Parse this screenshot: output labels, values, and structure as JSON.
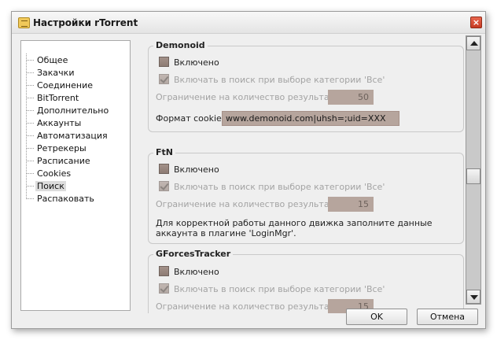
{
  "window": {
    "title": "Настройки rTorrent",
    "close_label": "×"
  },
  "sidebar": {
    "items": [
      {
        "label": "Общее"
      },
      {
        "label": "Закачки"
      },
      {
        "label": "Соединение"
      },
      {
        "label": "BitTorrent"
      },
      {
        "label": "Дополнительно"
      },
      {
        "label": "Аккаунты"
      },
      {
        "label": "Автоматизация"
      },
      {
        "label": "Ретрекеры"
      },
      {
        "label": "Расписание"
      },
      {
        "label": "Cookies"
      },
      {
        "label": "Поиск",
        "selected": true
      },
      {
        "label": "Распаковать"
      }
    ]
  },
  "engines": [
    {
      "name": "Demonoid",
      "enabled_label": "Включено",
      "enabled": false,
      "include_all_label": "Включать в поиск при выборе категории 'Все'",
      "include_all": true,
      "limit_label": "Ограничение на количество результатов:",
      "limit_value": "50",
      "cookies_label": "Формат cookies:",
      "cookies_value": "www.demonoid.com|uhsh=;uid=XXX"
    },
    {
      "name": "FtN",
      "enabled_label": "Включено",
      "enabled": false,
      "include_all_label": "Включать в поиск при выборе категории 'Все'",
      "include_all": true,
      "limit_label": "Ограничение на количество результатов:",
      "limit_value": "15",
      "note": "Для корректной работы данного движка заполните данные аккаунта в плагине 'LoginMgr'."
    },
    {
      "name": "GForcesTracker",
      "enabled_label": "Включено",
      "enabled": false,
      "include_all_label": "Включать в поиск при выборе категории 'Все'",
      "include_all": true,
      "limit_label": "Ограничение на количество результатов:",
      "limit_value": "15"
    }
  ],
  "buttons": {
    "ok": "OK",
    "cancel": "Отмена"
  },
  "colors": {
    "field_bg": "#b6a59d",
    "disabled_text": "#a3a3a3",
    "dialog_bg": "#efefef"
  }
}
